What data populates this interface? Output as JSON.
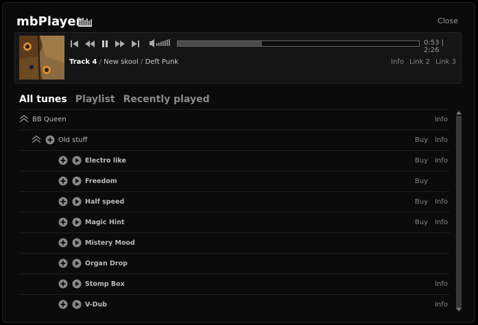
{
  "app": {
    "title": "mbPlayer",
    "close_label": "Close"
  },
  "player": {
    "time_label": "0:53 | 2:26",
    "progress": 0.35,
    "track_number": "Track 4",
    "album": "New skool",
    "artist": "Deft Punk",
    "links": [
      "Info",
      "Link 2",
      "Link 3"
    ]
  },
  "tabs": [
    {
      "label": "All tunes",
      "active": true
    },
    {
      "label": "Playlist",
      "active": false
    },
    {
      "label": "Recently played",
      "active": false
    }
  ],
  "list": {
    "group": {
      "label": "BB Queen",
      "info": "Info"
    },
    "subgroup": {
      "label": "Old stuff",
      "buy": "Buy",
      "info": "Info"
    },
    "tracks": [
      {
        "label": "Electro like",
        "buy": "Buy",
        "info": "Info"
      },
      {
        "label": "Freedom",
        "buy": "Buy",
        "info": ""
      },
      {
        "label": "Half speed",
        "buy": "Buy",
        "info": "Info"
      },
      {
        "label": "Magic Hint",
        "buy": "Buy",
        "info": "Info"
      },
      {
        "label": "Mistery Mood",
        "buy": "",
        "info": ""
      },
      {
        "label": "Organ Drop",
        "buy": "",
        "info": ""
      },
      {
        "label": "Stomp Box",
        "buy": "",
        "info": "Info"
      },
      {
        "label": "V-Dub",
        "buy": "",
        "info": "Info"
      }
    ]
  }
}
